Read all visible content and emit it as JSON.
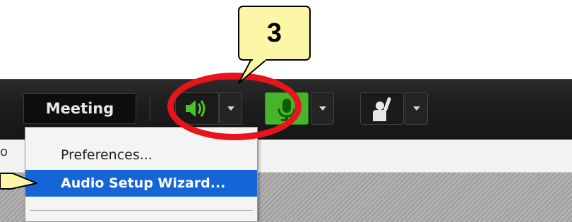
{
  "toolbar": {
    "meeting_label": "Meeting",
    "buttons": [
      {
        "name": "speaker",
        "icon": "speaker-icon",
        "active": true,
        "color": "#47b52b"
      },
      {
        "name": "microphone",
        "icon": "microphone-icon",
        "active": true,
        "color": "#47b52b"
      },
      {
        "name": "raise-hand",
        "icon": "raise-hand-icon",
        "active": false
      }
    ]
  },
  "menu": {
    "items": [
      {
        "label": "Preferences...",
        "selected": false
      },
      {
        "label": "Audio Setup Wizard...",
        "selected": true
      }
    ],
    "selected_color": "#1565d8"
  },
  "annotation": {
    "step_number": "3",
    "callout_color": "#fbf7a6",
    "ring_color": "#e8141c"
  },
  "panel": {
    "left_partial_char": "o"
  }
}
